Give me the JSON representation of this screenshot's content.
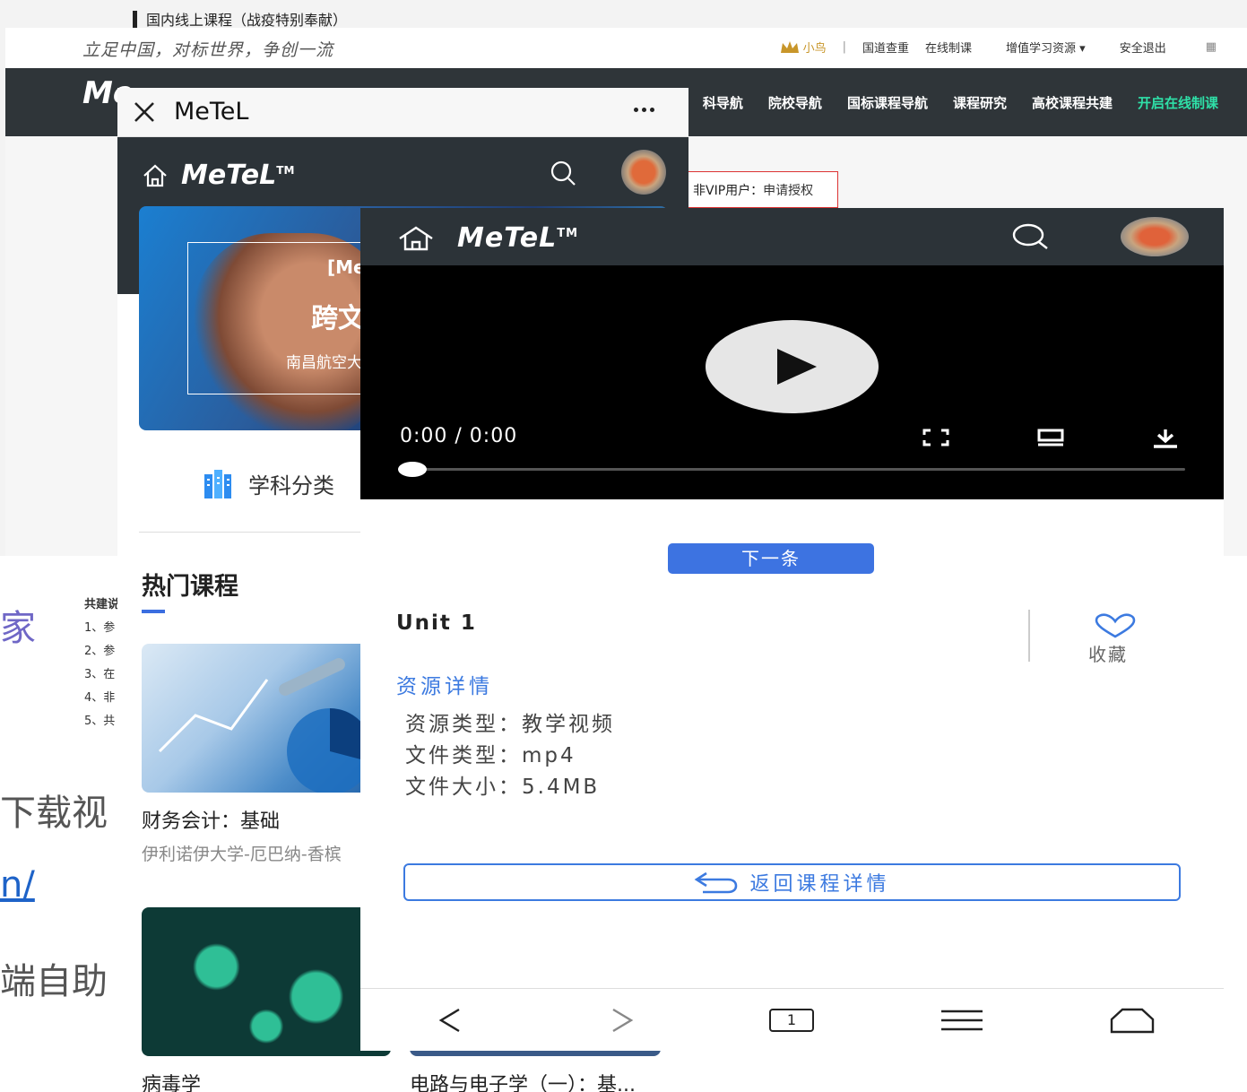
{
  "slide": {
    "title": "国内线上课程（战疫特别奉献）",
    "bottom_frag1": "下载视",
    "bottom_frag2": "n/",
    "bottom_frag3": "端自助"
  },
  "site": {
    "slogan": "立足中国，对标世界，争创一流",
    "toplinks": {
      "user": "小鸟",
      "sep": "|",
      "l1": "国道查重",
      "l2": "在线制课",
      "l3": "增值学习资源 ▾",
      "l4": "安全退出",
      "l5": "▦"
    },
    "logo": "Me",
    "nav": [
      "科导航",
      "院校导航",
      "国标课程导航",
      "课程研究",
      "高校课程共建",
      "开启在线制课"
    ],
    "vip": {
      "label": "非VIP用户：",
      "action": "申请授权"
    },
    "list": {
      "head": "共建说",
      "items": [
        "1、参",
        "2、参",
        "3、在",
        "4、非",
        "5、共"
      ]
    },
    "accent_green": "#2fe0a8",
    "dark_nav": "#2f3539"
  },
  "phone1": {
    "titlebar": {
      "close_icon": "close-icon",
      "name": "MeTeL",
      "more_icon": "more-icon"
    },
    "header": {
      "home_icon": "home-icon",
      "logo": "MeTeL",
      "tm": "TM",
      "search_icon": "search-icon"
    },
    "banner": {
      "line1": "[Me",
      "line2": "跨文",
      "line3": "南昌航空大"
    },
    "category": "学科分类",
    "hot_title": "热门课程",
    "courses": [
      {
        "title": "财务会计：基础",
        "sub": "伊利诺伊大学-厄巴纳-香槟"
      },
      {
        "title": "病毒学",
        "sub": ""
      },
      {
        "title": "电路与电子学（一）：基...",
        "sub": ""
      }
    ]
  },
  "phone2": {
    "header": {
      "home_icon": "home-icon",
      "logo": "MeTeL",
      "tm": "TM",
      "search_icon": "search-icon"
    },
    "video": {
      "time": "0:00 / 0:00",
      "progress": 0,
      "fullscreen_icon": "fullscreen-icon",
      "screen_icon": "screen-icon",
      "download_icon": "download-icon"
    },
    "next_label": "下一条",
    "unit": "Unit 1",
    "favorite_label": "收藏",
    "resource": {
      "title": "资源详情",
      "type": "资源类型：教学视频",
      "file_type": "文件类型：mp4",
      "size": "文件大小：5.4MB"
    },
    "back_label": "返回课程详情",
    "bottom_nav": {
      "back": "back-icon",
      "forward": "forward-icon",
      "tabs": "1",
      "menu": "menu-icon",
      "home": "home-outline-icon"
    },
    "accent_blue": "#3c7ae0"
  }
}
